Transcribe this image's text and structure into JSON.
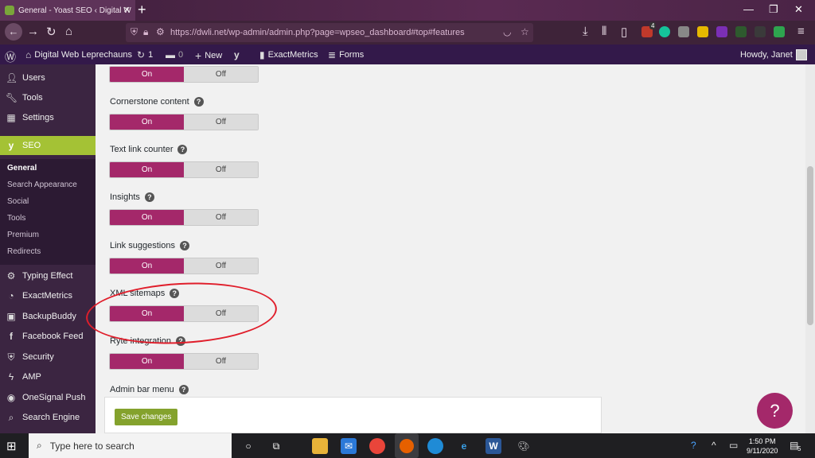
{
  "browser": {
    "tab_title": "General - Yoast SEO ‹ Digital W",
    "new_tab": "+",
    "url": "https://dwli.net/wp-admin/admin.php?page=wpseo_dashboard#top#features",
    "ext_badge": "4"
  },
  "adminbar": {
    "site_name": "Digital Web Leprechauns",
    "updates": "1",
    "comments": "0",
    "new_label": "New",
    "exactmetrics": "ExactMetrics",
    "forms": "Forms",
    "howdy": "Howdy, Janet"
  },
  "sidebar": {
    "items": [
      {
        "label": "Users"
      },
      {
        "label": "Tools"
      },
      {
        "label": "Settings"
      },
      {
        "label": "SEO"
      },
      {
        "label": "Typing Effect"
      },
      {
        "label": "ExactMetrics"
      },
      {
        "label": "BackupBuddy"
      },
      {
        "label": "Facebook Feed"
      },
      {
        "label": "Security"
      },
      {
        "label": "AMP"
      },
      {
        "label": "OneSignal Push"
      },
      {
        "label": "Search Engine"
      }
    ],
    "seo_sub": [
      "General",
      "Search Appearance",
      "Social",
      "Tools",
      "Premium",
      "Redirects"
    ]
  },
  "features": [
    {
      "label": ""
    },
    {
      "label": "Cornerstone content"
    },
    {
      "label": "Text link counter"
    },
    {
      "label": "Insights"
    },
    {
      "label": "Link suggestions"
    },
    {
      "label": "XML sitemaps"
    },
    {
      "label": "Ryte integration"
    },
    {
      "label": "Admin bar menu"
    }
  ],
  "toggle": {
    "on": "On",
    "off": "Off"
  },
  "help_symbol": "?",
  "save_label": "Save changes",
  "help_fab": "?",
  "taskbar": {
    "search_placeholder": "Type here to search",
    "time": "1:50 PM",
    "date": "9/11/2020",
    "notifications": "5"
  },
  "colors": {
    "toggle_on": "#a4286a",
    "seo_active": "#a4c235",
    "highlight_circle": "#e01e2b",
    "save_button": "#84a22d"
  }
}
